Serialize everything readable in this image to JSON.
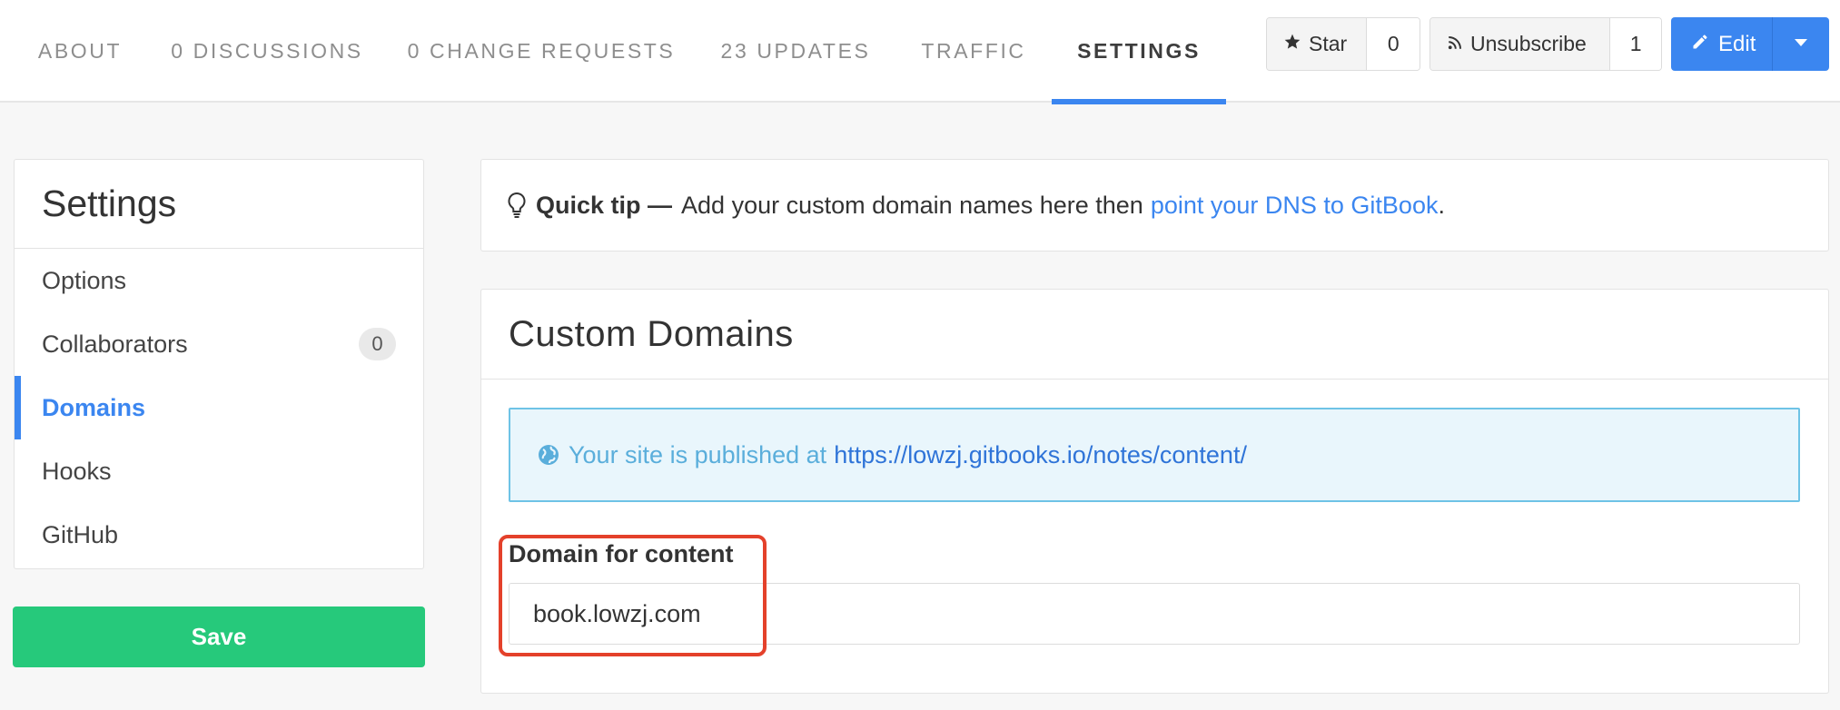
{
  "tabs": [
    {
      "label": "ABOUT"
    },
    {
      "label": "0 DISCUSSIONS"
    },
    {
      "label": "0 CHANGE REQUESTS"
    },
    {
      "label": "23 UPDATES"
    },
    {
      "label": "TRAFFIC"
    },
    {
      "label": "SETTINGS",
      "active": true
    }
  ],
  "actions": {
    "star_label": "Star",
    "star_count": "0",
    "unsubscribe_label": "Unsubscribe",
    "unsubscribe_count": "1",
    "edit_label": "Edit"
  },
  "sidebar": {
    "title": "Settings",
    "items": [
      {
        "label": "Options"
      },
      {
        "label": "Collaborators",
        "badge": "0"
      },
      {
        "label": "Domains",
        "active": true
      },
      {
        "label": "Hooks"
      },
      {
        "label": "GitHub"
      }
    ],
    "save_label": "Save"
  },
  "tip": {
    "title": "Quick tip —",
    "text": "Add your custom domain names here then",
    "link": "point your DNS to GitBook",
    "end": "."
  },
  "domains": {
    "title": "Custom Domains",
    "published_text": "Your site is published at",
    "published_url": "https://lowzj.gitbooks.io/notes/content/",
    "field_label": "Domain for content",
    "field_value": "book.lowzj.com"
  },
  "colors": {
    "accent": "#3b86f0",
    "save": "#26c97b",
    "info_bg": "#e9f6fc",
    "highlight": "#e4412b"
  },
  "icons": [
    "star-icon",
    "rss-icon",
    "pencil-icon",
    "caret-down-icon",
    "lightbulb-icon",
    "globe-icon"
  ]
}
